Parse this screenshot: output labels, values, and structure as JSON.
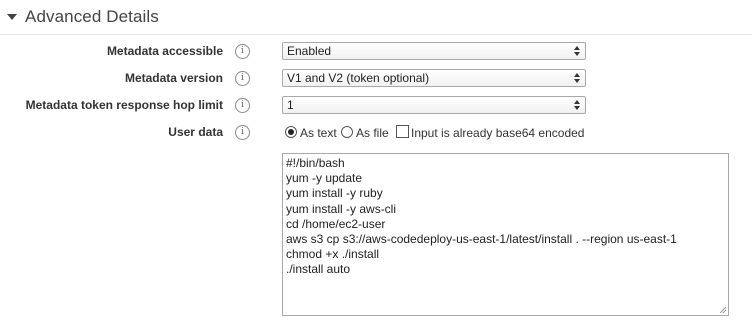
{
  "section": {
    "title": "Advanced Details",
    "caret_icon": "caret-down-icon"
  },
  "fields": {
    "metadata_accessible": {
      "label": "Metadata accessible",
      "value": "Enabled"
    },
    "metadata_version": {
      "label": "Metadata version",
      "value": "V1 and V2 (token optional)"
    },
    "hop_limit": {
      "label": "Metadata token response hop limit",
      "value": "1"
    },
    "user_data": {
      "label": "User data",
      "as_text": "As text",
      "as_file": "As file",
      "base64_label": "Input is already base64 encoded",
      "selected": "As text",
      "base64_checked": false,
      "lines": [
        "#!/bin/bash",
        "yum -y update",
        "yum install -y ruby",
        "yum install -y aws-cli",
        "cd /home/ec2-user",
        "aws s3 cp s3://aws-codedeploy-us-east-1/latest/install . --region us-east-1",
        "chmod +x ./install",
        "./install auto"
      ]
    }
  },
  "info_icon_glyph": "i"
}
